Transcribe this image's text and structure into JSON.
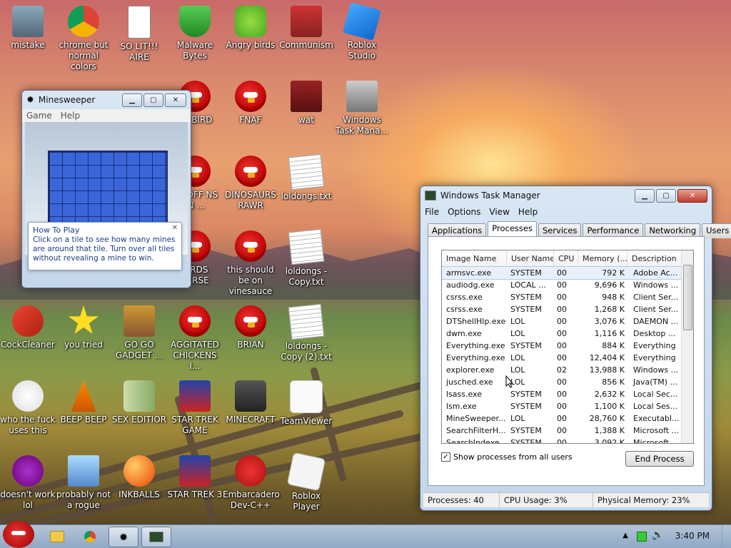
{
  "desktop_icons": [
    {
      "label": "mistake",
      "icon": "computer-icon"
    },
    {
      "label": "chrome but normal colors",
      "icon": "chrome-icon"
    },
    {
      "label": "SO LIT!!! AIRE",
      "icon": "solitaire-icon"
    },
    {
      "label": "Malware Bytes",
      "icon": "shield-icon"
    },
    {
      "label": "Angry birds",
      "icon": "pig-icon"
    },
    {
      "label": "Communism",
      "icon": "communism-icon"
    },
    {
      "label": "Roblox Studio",
      "icon": "roblox-studio-icon"
    },
    {
      "label": "ER BIRD",
      "icon": "angry-bird-icon"
    },
    {
      "label": "FNAF",
      "icon": "angry-bird-icon"
    },
    {
      "label": "wat",
      "icon": "flash-icon"
    },
    {
      "label": "Windows Task Mana...",
      "icon": "task-manager-icon"
    },
    {
      "label": "ED OFF NS IN ...",
      "icon": "angry-bird-icon"
    },
    {
      "label": "DINOSAURS RAWR",
      "icon": "angry-bird-icon"
    },
    {
      "label": "loldongs.txt",
      "icon": "text-file-icon"
    },
    {
      "label": "BIRDS VERSE",
      "icon": "angry-bird-icon"
    },
    {
      "label": "this should be on vinesauce",
      "icon": "angry-bird-icon"
    },
    {
      "label": "loldongs - Copy.txt",
      "icon": "text-file-icon"
    },
    {
      "label": "CockCleaner",
      "icon": "broom-icon"
    },
    {
      "label": "you tried",
      "icon": "star-icon"
    },
    {
      "label": "GO GO GADGET ...",
      "icon": "briefcase-icon"
    },
    {
      "label": "AGGITATED CHICKENS I...",
      "icon": "angry-bird-icon"
    },
    {
      "label": "BRIAN",
      "icon": "angry-bird-icon"
    },
    {
      "label": "loldongs - Copy (2).txt",
      "icon": "text-file-icon"
    },
    {
      "label": "who the fuck uses this",
      "icon": "winamp-icon"
    },
    {
      "label": "BEEP BEEP",
      "icon": "vlc-icon"
    },
    {
      "label": "SEX EDITIOR",
      "icon": "hxd-icon"
    },
    {
      "label": "STAR TREK GAME",
      "icon": "star-trek-icon"
    },
    {
      "label": "MINECRAFT",
      "icon": "minecraft-icon"
    },
    {
      "label": "TeamViewer",
      "icon": "blank-icon"
    },
    {
      "label": "doesn't work lol",
      "icon": "yahoo-icon"
    },
    {
      "label": "probably not a rogue",
      "icon": "gear-monitor-icon"
    },
    {
      "label": "INKBALLS",
      "icon": "ink-ball-icon"
    },
    {
      "label": "STAR TREK 3",
      "icon": "star-trek-icon"
    },
    {
      "label": "Embarcadero Dev-C++",
      "icon": "dev-cpp-icon"
    },
    {
      "label": "Roblox Player",
      "icon": "roblox-icon"
    }
  ],
  "minesweeper": {
    "title": "Minesweeper",
    "menu": [
      "Game",
      "Help"
    ],
    "how_to_title": "How To Play",
    "how_to_body": "Click on a tile to see how many mines are around that tile. Turn over all tiles without revealing a mine to win."
  },
  "task_manager": {
    "title": "Windows Task Manager",
    "menu": [
      "File",
      "Options",
      "View",
      "Help"
    ],
    "tabs": [
      "Applications",
      "Processes",
      "Services",
      "Performance",
      "Networking",
      "Users"
    ],
    "active_tab": "Processes",
    "columns": [
      "Image Name",
      "User Name",
      "CPU",
      "Memory (...",
      "Description"
    ],
    "processes": [
      {
        "name": "armsvc.exe",
        "user": "SYSTEM",
        "cpu": "00",
        "mem": "792 K",
        "desc": "Adobe Ac..."
      },
      {
        "name": "audiodg.exe",
        "user": "LOCAL ...",
        "cpu": "00",
        "mem": "9,696 K",
        "desc": "Windows ..."
      },
      {
        "name": "csrss.exe",
        "user": "SYSTEM",
        "cpu": "00",
        "mem": "948 K",
        "desc": "Client Ser..."
      },
      {
        "name": "csrss.exe",
        "user": "SYSTEM",
        "cpu": "00",
        "mem": "1,268 K",
        "desc": "Client Ser..."
      },
      {
        "name": "DTShellHlp.exe",
        "user": "LOL",
        "cpu": "00",
        "mem": "3,076 K",
        "desc": "DAEMON ..."
      },
      {
        "name": "dwm.exe",
        "user": "LOL",
        "cpu": "00",
        "mem": "1,116 K",
        "desc": "Desktop ..."
      },
      {
        "name": "Everything.exe",
        "user": "SYSTEM",
        "cpu": "00",
        "mem": "884 K",
        "desc": "Everything"
      },
      {
        "name": "Everything.exe",
        "user": "LOL",
        "cpu": "00",
        "mem": "12,404 K",
        "desc": "Everything"
      },
      {
        "name": "explorer.exe",
        "user": "LOL",
        "cpu": "02",
        "mem": "13,988 K",
        "desc": "Windows ..."
      },
      {
        "name": "jusched.exe",
        "user": "LOL",
        "cpu": "00",
        "mem": "856 K",
        "desc": "Java(TM) ..."
      },
      {
        "name": "lsass.exe",
        "user": "SYSTEM",
        "cpu": "00",
        "mem": "2,632 K",
        "desc": "Local Sec..."
      },
      {
        "name": "lsm.exe",
        "user": "SYSTEM",
        "cpu": "00",
        "mem": "1,100 K",
        "desc": "Local Ses..."
      },
      {
        "name": "MineSweeper....",
        "user": "LOL",
        "cpu": "00",
        "mem": "28,760 K",
        "desc": "Executabl..."
      },
      {
        "name": "SearchFilterH...",
        "user": "SYSTEM",
        "cpu": "00",
        "mem": "1,388 K",
        "desc": "Microsoft ..."
      },
      {
        "name": "SearchIndexe...",
        "user": "SYSTEM",
        "cpu": "00",
        "mem": "3,092 K",
        "desc": "Microsoft ..."
      }
    ],
    "show_all_label": "Show processes from all users",
    "end_process_label": "End Process",
    "status_processes": "Processes: 40",
    "status_cpu": "CPU Usage: 3%",
    "status_memory": "Physical Memory: 23%"
  },
  "taskbar": {
    "clock": "3:40 PM"
  },
  "colors": {
    "accent": "#1a3d8a",
    "close": "#c23a2a",
    "mine_tile": "#3a66d8"
  }
}
